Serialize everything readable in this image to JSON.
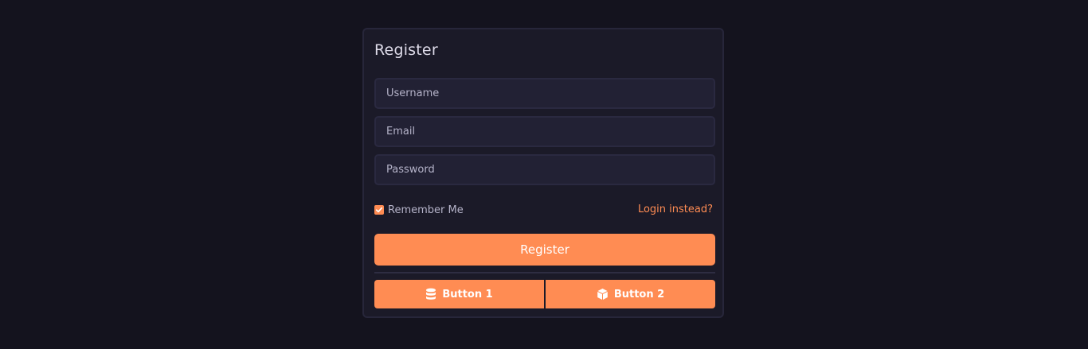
{
  "form": {
    "title": "Register",
    "username_placeholder": "Username",
    "email_placeholder": "Email",
    "password_placeholder": "Password",
    "remember_label": "Remember Me",
    "remember_checked": true,
    "login_link": "Login instead?",
    "submit_label": "Register"
  },
  "button_group": {
    "button1": {
      "label": "Button 1",
      "icon": "database-icon"
    },
    "button2": {
      "label": "Button 2",
      "icon": "cube-icon"
    }
  },
  "colors": {
    "background": "#14131e",
    "card": "#1b1a28",
    "accent": "#ff8c53",
    "input_bg": "#222134",
    "text_muted": "#b5b3c9"
  }
}
